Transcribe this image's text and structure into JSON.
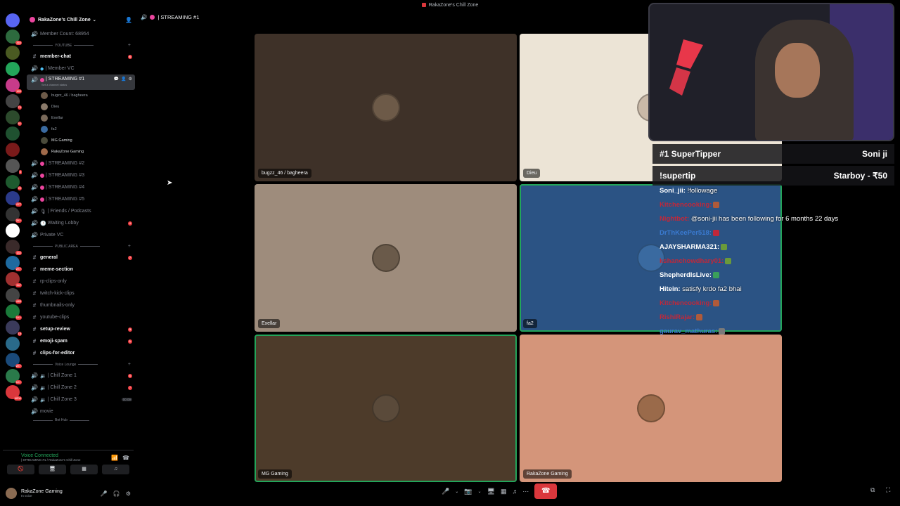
{
  "window_title": "RakaZone's Chill Zone",
  "server": {
    "name": "RakaZone's Chill Zone",
    "member_count": "Member Count: 68954",
    "items": [
      {
        "color": "#5865f2",
        "badge": ""
      },
      {
        "color": "#2d6a3e",
        "badge": "364"
      },
      {
        "color": "#4a5a22",
        "badge": ""
      },
      {
        "color": "#23a55a",
        "badge": ""
      },
      {
        "color": "#c73b8a",
        "badge": "189"
      },
      {
        "color": "#444",
        "badge": "74"
      },
      {
        "color": "#2c4a2c",
        "badge": "61"
      },
      {
        "color": "#1f5130",
        "badge": ""
      },
      {
        "color": "#7a1a1a",
        "badge": ""
      },
      {
        "color": "#555",
        "badge": "9"
      },
      {
        "color": "#1e5a2f",
        "badge": "22"
      },
      {
        "color": "#2b3a8a",
        "badge": "677"
      },
      {
        "color": "#333",
        "badge": "2K+"
      },
      {
        "color": "#ffffff",
        "badge": ""
      },
      {
        "color": "#3a2a2a",
        "badge": "152"
      },
      {
        "color": "#1e6aa0",
        "badge": "2K+"
      },
      {
        "color": "#a03030",
        "badge": "347"
      },
      {
        "color": "#444",
        "badge": "44B"
      },
      {
        "color": "#1a7a3a",
        "badge": "1K+"
      },
      {
        "color": "#3a3a5a",
        "badge": "18"
      },
      {
        "color": "#2a6a8a",
        "badge": ""
      },
      {
        "color": "#1a4a7a",
        "badge": "2K+"
      },
      {
        "color": "#2a7a4a",
        "badge": "1K+"
      },
      {
        "color": "#da373c",
        "badge": "NEW"
      }
    ]
  },
  "sidebar": {
    "cat_youtube": "YOUTUBE",
    "member_chat": "member-chat",
    "member_chat_count": "6",
    "member_vc": "| Member VC",
    "streaming1": "| STREAMING #1",
    "streaming1_status": "Set a channel status",
    "voice_users": [
      {
        "name": "bugzz_46 / bagheera",
        "color": "#6d5a48"
      },
      {
        "name": "Dieu",
        "color": "#8a7a6a"
      },
      {
        "name": "Exellar",
        "color": "#7a6a5a"
      },
      {
        "name": "fa2",
        "color": "#3a6aa0"
      },
      {
        "name": "MG Gaming",
        "color": "#4a4a3a"
      },
      {
        "name": "RakaZone Gaming",
        "color": "#a06a4a"
      }
    ],
    "streaming2": "| STREAMING #2",
    "streaming3": "| STREAMING #3",
    "streaming4": "| STREAMING #4",
    "streaming5": "| STREAMING #5",
    "friends": "| Friends / Podcasts",
    "waiting": "Waiting Lobby",
    "waiting_count": "4",
    "private_vc": "Private VC",
    "cat_public": "PUBLIC AREA",
    "general": "general",
    "general_count": "7",
    "meme": "meme-section",
    "rp_clips": "rp-clips-only",
    "twitch_clips": "twitch-kick-clips",
    "thumbnails": "thumbnails-only",
    "yt_clips": "youtube-clips",
    "setup": "setup-review",
    "setup_count": "3",
    "emoji_spam": "emoji-spam",
    "emoji_count": "1",
    "clips_editor": "clips-for-editor",
    "cat_voice": "Voice Lounge",
    "chill1": "| Chill Zone 1",
    "chill1_count": "6",
    "chill2": "| Chill Zone 2",
    "chill2_count": "7",
    "chill3": "| Chill Zone 3",
    "chill3_meta": "00 09",
    "movie": "movie",
    "cat_bot": "Bot Hub"
  },
  "voice_panel": {
    "status": "Voice Connected",
    "channel": "| STREAMING #1 / RakaZone's Chill Zone"
  },
  "user": {
    "name": "RakaZone Gaming",
    "status": "In voice"
  },
  "channel_title": "| STREAMING #1",
  "tiles": [
    {
      "label": "bugzz_46 / bagheera",
      "bg": "#3e3128",
      "speaking": false,
      "avatar": "#6d5a48"
    },
    {
      "label": "Dieu",
      "bg": "#ece4d6",
      "speaking": false,
      "avatar": "#c9b9a8"
    },
    {
      "label": "Exellar",
      "bg": "#9e8c7c",
      "speaking": false,
      "avatar": "#6a5a4a"
    },
    {
      "label": "fa2",
      "bg": "#2b5384",
      "speaking": true,
      "avatar": "#3a6aa0"
    },
    {
      "label": "MG Gaming",
      "bg": "#4d3b2a",
      "speaking": true,
      "avatar": "#5a4a3a"
    },
    {
      "label": "RakaZone Gaming",
      "bg": "#d4957a",
      "speaking": false,
      "avatar": "#9a6a4a"
    }
  ],
  "overlay": {
    "supertipper_label": "#1 SuperTipper",
    "supertipper_name": "Soni ji",
    "command": "!supertip",
    "tip": "Starboy - ₹50"
  },
  "chat": [
    {
      "user": "Soni_jii:",
      "user_color": "#ffffff",
      "text": "!followage",
      "emoji": ""
    },
    {
      "user": "Kitchencooking:",
      "user_color": "#c0283a",
      "text": "",
      "emoji": "#b05a3a"
    },
    {
      "user": "Nightbot:",
      "user_color": "#c0283a",
      "text": "@soni-jii has been following for 6 months 22 days",
      "emoji": ""
    },
    {
      "user": "DrThKeePer518:",
      "user_color": "#3a7ad0",
      "text": "",
      "emoji": "#c0283a"
    },
    {
      "user": "AJAYSHARMA321:",
      "user_color": "#ffffff",
      "text": "",
      "emoji": "#6a9a3a"
    },
    {
      "user": "kshanchowdhary01:",
      "user_color": "#c0283a",
      "text": "",
      "emoji": "#6a9a3a"
    },
    {
      "user": "ShepherdIsLive:",
      "user_color": "#ffffff",
      "text": "",
      "emoji": "#3aa05a"
    },
    {
      "user": "Hitein:",
      "user_color": "#ffffff",
      "text": "satisfy krdo fa2 bhai",
      "emoji": ""
    },
    {
      "user": "Kitchencooking:",
      "user_color": "#c0283a",
      "text": "",
      "emoji": "#b05a3a"
    },
    {
      "user": "RishiRajar:",
      "user_color": "#c0283a",
      "text": "",
      "emoji": "#b05a3a"
    },
    {
      "user": "gaurav_mathuras:",
      "user_color": "#3a7ad0",
      "text": "",
      "emoji": "#7a7a7a"
    }
  ]
}
